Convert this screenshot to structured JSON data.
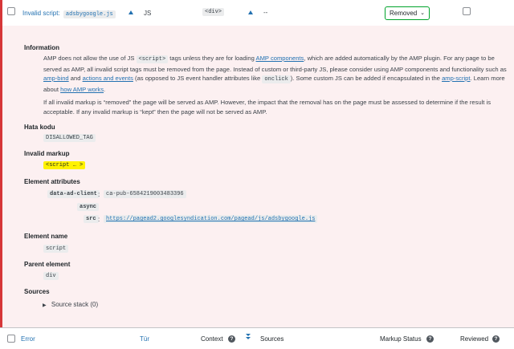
{
  "row": {
    "error_prefix": "Invalid script:",
    "error_code": "adsbygoogle.js",
    "type": "JS",
    "context": "<div>",
    "sources": "--",
    "status": "Removed"
  },
  "details": {
    "information_heading": "Information",
    "info_p1_a": "AMP does not allow the use of JS",
    "info_p1_code": "<script>",
    "info_p1_b": "tags unless they are for loading",
    "info_p1_link_amp_components": "AMP components",
    "info_p1_c": ", which are added automatically by the AMP plugin. For any page to be",
    "info_p1_line2": "served as AMP, all invalid script tags must be removed from the page. Instead of custom or third-party JS, please consider using AMP components and functionality such as",
    "info_p1_link_amp_bind": "amp-bind",
    "info_p1_and": "and",
    "info_p1_link_actions": "actions and events",
    "info_p1_d": "(as opposed to JS event handler attributes like",
    "info_p1_onclick": "onclick",
    "info_p1_e": "). Some custom JS can be added if encapsulated in the",
    "info_p1_link_amp_script": "amp-script",
    "info_p1_f": ". Learn more",
    "info_p1_about": "about",
    "info_p1_link_how": "how AMP works",
    "info_p1_end": ".",
    "info_p2_line1": "If all invalid markup is “removed” the page will be served as AMP. However, the impact that the removal has on the page must be assessed to determine if the result is",
    "info_p2_line2": "acceptable. If any invalid markup is “kept” then the page will not be served as AMP.",
    "error_code_heading": "Hata kodu",
    "error_code_value": "DISALLOWED_TAG",
    "invalid_markup_heading": "Invalid markup",
    "invalid_markup_value": "<script … >",
    "element_attributes_heading": "Element attributes",
    "attr1_name": "data-ad-client",
    "attr1_value": "ca-pub-6584219003483396",
    "attr2_name": "async",
    "attr3_name": "src",
    "attr3_value": "https://pagead2.googlesyndication.com/pagead/js/adsbygoogle.js",
    "element_name_heading": "Element name",
    "element_name_value": "script",
    "parent_element_heading": "Parent element",
    "parent_element_value": "div",
    "sources_heading": "Sources",
    "source_stack_label": "Source stack (0)"
  },
  "footer": {
    "col_error": "Error",
    "col_type": "Tür",
    "col_context": "Context",
    "col_sources": "Sources",
    "col_markup_status": "Markup Status",
    "col_reviewed": "Reviewed"
  },
  "colors": {
    "accent": "#d63638",
    "link": "#2271b1",
    "status_border": "#00a32a",
    "highlight": "#fff200"
  },
  "icons": {
    "sort_up": "triangle-up-icon",
    "help": "question-circle-icon",
    "chevron": "chevron-down-icon",
    "sort_both": "sort-arrows-icon",
    "disclosure": "triangle-right-icon"
  }
}
